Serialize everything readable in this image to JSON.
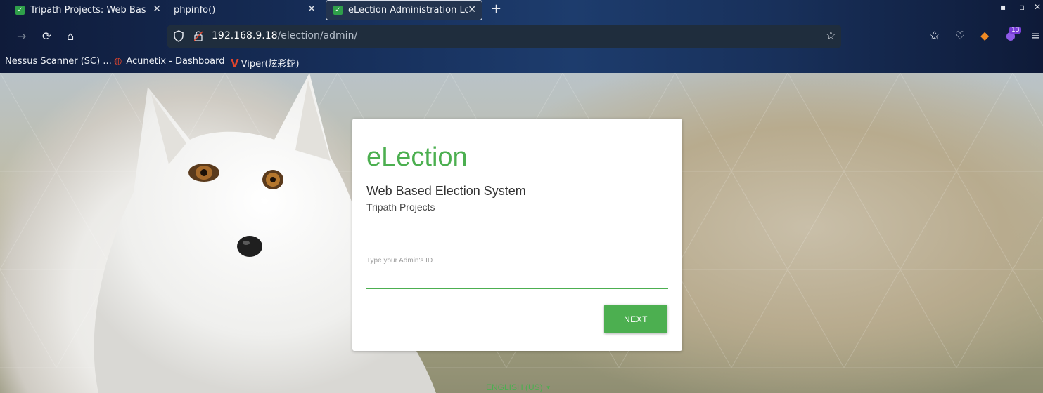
{
  "browser": {
    "tabs": [
      {
        "title": "Tripath Projects: Web Based",
        "active": false,
        "has_favicon": true
      },
      {
        "title": "phpinfo()",
        "active": false,
        "has_favicon": false
      },
      {
        "title": "eLection Administration Login",
        "active": true,
        "has_favicon": true
      }
    ],
    "new_tab_label": "+",
    "url_host": "192.168.9.18",
    "url_path": "/election/admin/",
    "extension_badge": "13",
    "bookmarks": [
      {
        "label": "Nessus Scanner (SC) ...",
        "icon": "none"
      },
      {
        "label": "Acunetix - Dashboard",
        "icon": "acunetix-icon"
      },
      {
        "label": "Viper(炫彩蛇)",
        "icon": "viper-icon"
      }
    ]
  },
  "login": {
    "logo": "eLection",
    "subtitle": "Web Based Election System",
    "organization": "Tripath Projects",
    "admin_id_label": "Type your Admin's ID",
    "admin_id_value": "",
    "next_button": "NEXT",
    "language": "ENGLISH (US)"
  },
  "colors": {
    "accent": "#4caf50",
    "card": "#ffffff",
    "url_bar": "#1f2d3d"
  }
}
